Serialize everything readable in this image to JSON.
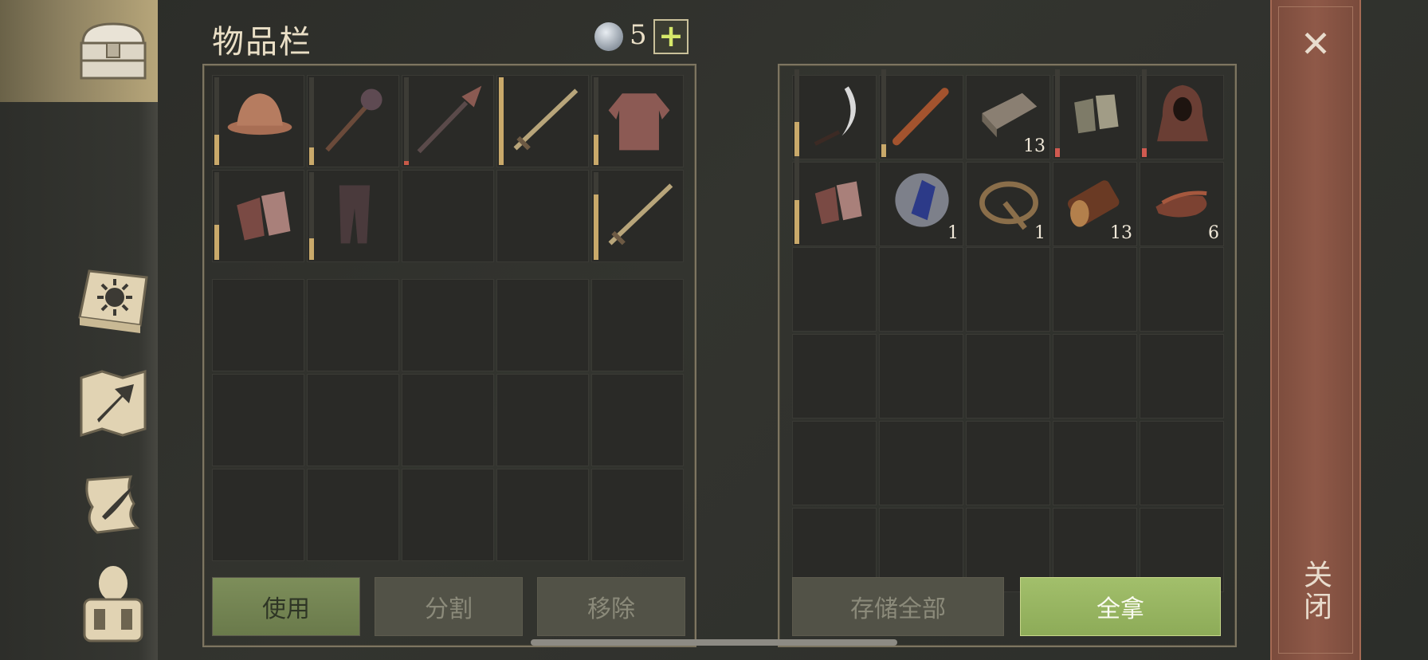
{
  "header": {
    "title": "物品栏",
    "currency_icon": "silver-coin-icon",
    "currency_count": "5",
    "add_label": "+"
  },
  "inventory": {
    "slots": [
      {
        "name": "helmet-icon",
        "durability": 0.35,
        "bar_color": "#c9a96a"
      },
      {
        "name": "flail-icon",
        "durability": 0.2,
        "bar_color": "#c9a96a"
      },
      {
        "name": "spiked-mace-icon",
        "durability": 0.05,
        "bar_color": "#c85a48"
      },
      {
        "name": "sword-icon",
        "durability": 1.0,
        "bar_color": "#c9a96a"
      },
      {
        "name": "chainmail-shirt-icon",
        "durability": 0.35,
        "bar_color": "#c9a96a"
      },
      {
        "name": "chainmail-gloves-icon",
        "durability": 0.4,
        "bar_color": "#c9a96a"
      },
      {
        "name": "chainmail-leggings-icon",
        "durability": 0.25,
        "bar_color": "#c9a96a"
      },
      {
        "name": "empty",
        "durability": null
      },
      {
        "name": "empty",
        "durability": null
      },
      {
        "name": "sword-icon",
        "durability": 0.75,
        "bar_color": "#c9a96a"
      }
    ]
  },
  "container": {
    "slots": [
      {
        "name": "sickle-icon",
        "durability": 0.4,
        "bar_color": "#c9a96a",
        "qty": ""
      },
      {
        "name": "club-icon",
        "durability": 0.15,
        "bar_color": "#c9a96a",
        "qty": ""
      },
      {
        "name": "wood-plank-icon",
        "durability": null,
        "qty": "13"
      },
      {
        "name": "cloth-gloves-icon",
        "durability": 0.1,
        "bar_color": "#d05a50",
        "qty": ""
      },
      {
        "name": "hood-icon",
        "durability": 0.1,
        "bar_color": "#d05a50",
        "qty": ""
      },
      {
        "name": "chainmail-gloves-icon",
        "durability": 0.5,
        "bar_color": "#c9a96a",
        "qty": ""
      },
      {
        "name": "crystal-icon",
        "durability": null,
        "qty": "1"
      },
      {
        "name": "bear-trap-icon",
        "durability": null,
        "qty": "1"
      },
      {
        "name": "log-icon",
        "durability": null,
        "qty": "13"
      },
      {
        "name": "leather-strips-icon",
        "durability": null,
        "qty": "6"
      }
    ]
  },
  "buttons": {
    "use": "使用",
    "split": "分割",
    "remove": "移除",
    "store_all": "存储全部",
    "take_all": "全拿"
  },
  "close": {
    "label": "关闭",
    "icon": "close-icon"
  },
  "sidebar": {
    "items": [
      "chest-icon",
      "sun-book-icon",
      "map-arrow-icon",
      "scroll-quill-icon",
      "backpack-character-icon"
    ]
  }
}
